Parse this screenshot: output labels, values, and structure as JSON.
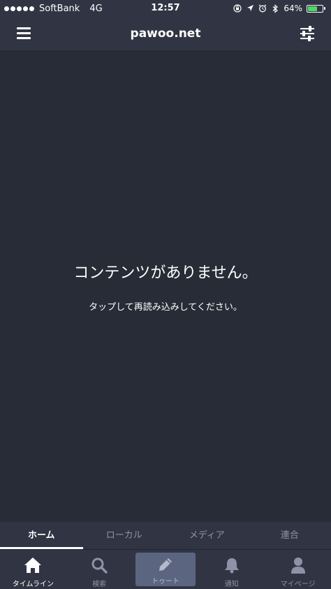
{
  "status_bar": {
    "carrier": "SoftBank",
    "network": "4G",
    "time": "12:57",
    "battery_percent": "64%",
    "battery_level": 0.64,
    "icons": [
      "orientation-lock-icon",
      "location-icon",
      "alarm-icon",
      "bluetooth-icon"
    ]
  },
  "header": {
    "title": "pawoo.net",
    "menu_icon": "hamburger-icon",
    "settings_icon": "sliders-icon"
  },
  "main": {
    "empty_title": "コンテンツがありません。",
    "empty_subtitle": "タップして再読み込みしてください。"
  },
  "tabs": [
    {
      "label": "ホーム",
      "active": true
    },
    {
      "label": "ローカル",
      "active": false
    },
    {
      "label": "メディア",
      "active": false
    },
    {
      "label": "連合",
      "active": false
    }
  ],
  "bottom_nav": [
    {
      "label": "タイムライン",
      "icon": "home-icon",
      "active": true
    },
    {
      "label": "検索",
      "icon": "search-icon",
      "active": false
    },
    {
      "label": "トゥート",
      "icon": "pencil-icon",
      "active": false
    },
    {
      "label": "通知",
      "icon": "bell-icon",
      "active": false
    },
    {
      "label": "マイページ",
      "icon": "user-icon",
      "active": false
    }
  ],
  "colors": {
    "background": "#282c37",
    "bar": "#313543",
    "inactive": "#8d93a6",
    "toot_button": "#5c6580",
    "battery": "#4cd964"
  }
}
